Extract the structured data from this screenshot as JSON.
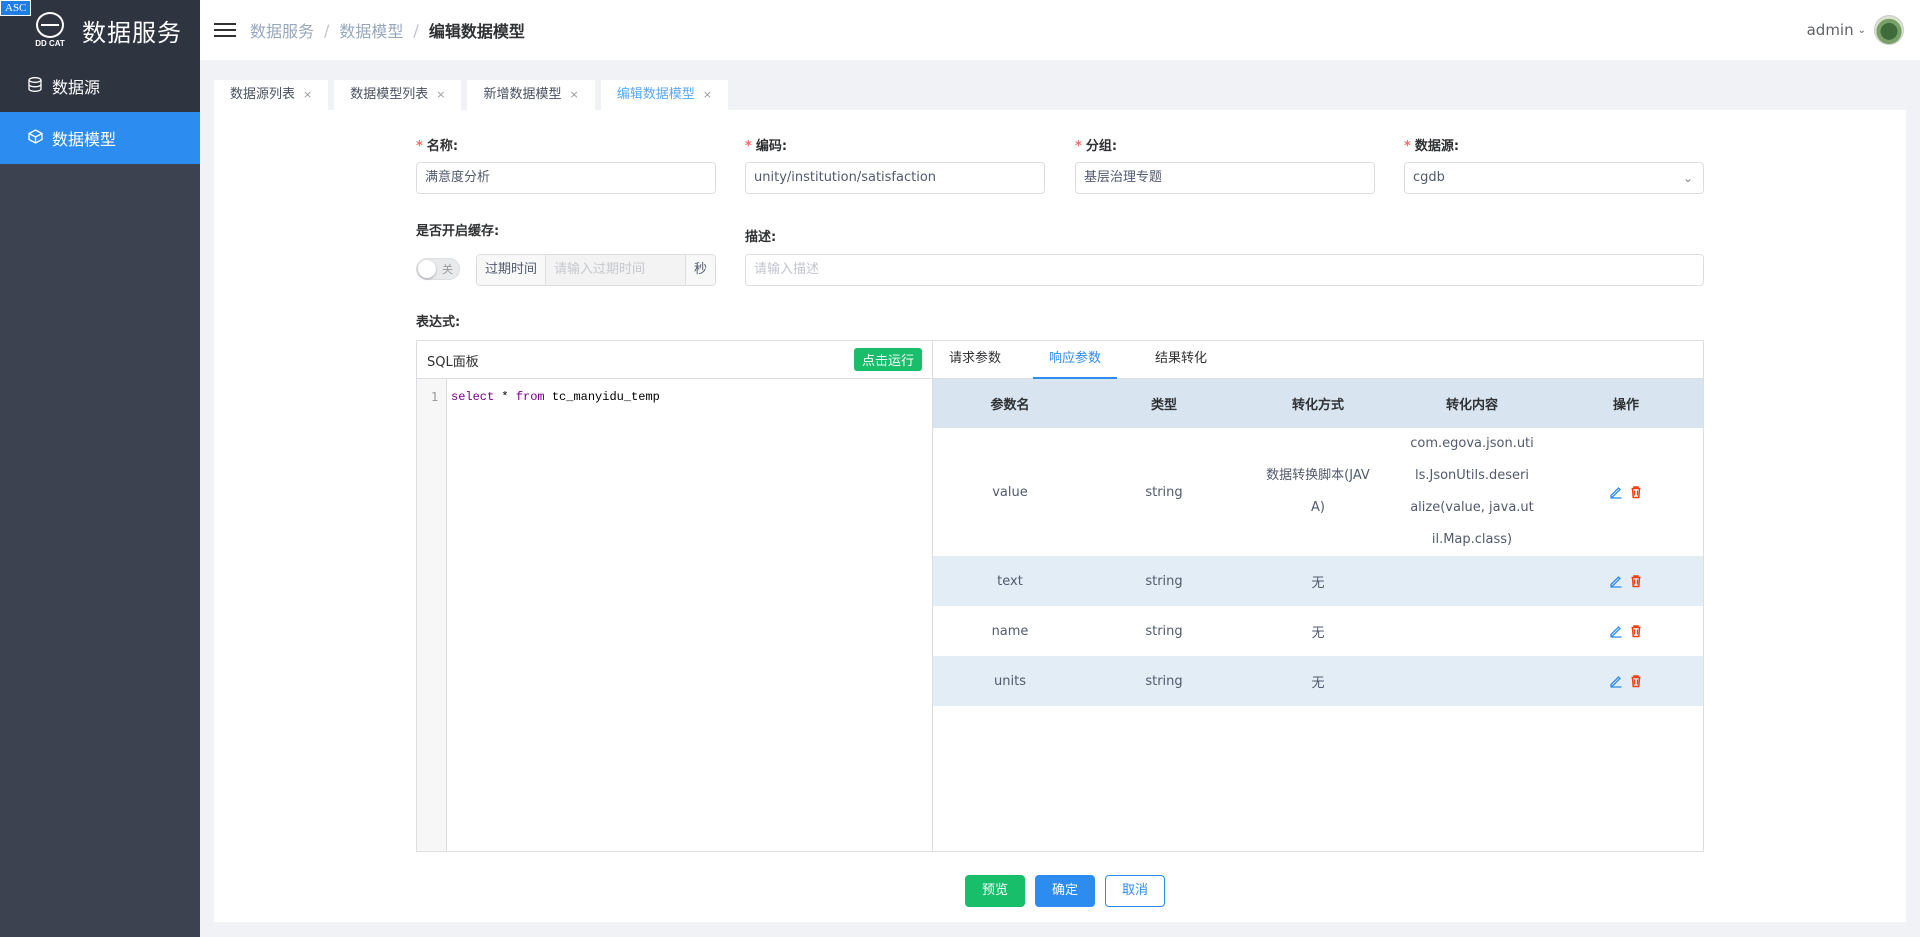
{
  "app": {
    "badge": "ASC",
    "logo_text": "DD CAT",
    "title": "数据服务"
  },
  "sidebar": {
    "items": [
      {
        "label": "数据源"
      },
      {
        "label": "数据模型"
      }
    ]
  },
  "header": {
    "breadcrumb": [
      "数据服务",
      "数据模型",
      "编辑数据模型"
    ],
    "user": "admin"
  },
  "tabs": [
    {
      "label": "数据源列表"
    },
    {
      "label": "数据模型列表"
    },
    {
      "label": "新增数据模型"
    },
    {
      "label": "编辑数据模型"
    }
  ],
  "form": {
    "name_label": "名称:",
    "name_value": "满意度分析",
    "code_label": "编码:",
    "code_value": "unity/institution/satisfaction",
    "group_label": "分组:",
    "group_value": "基层治理专题",
    "datasource_label": "数据源:",
    "datasource_value": "cgdb",
    "cache_label": "是否开启缓存:",
    "cache_switch_text": "关",
    "expire_addon": "过期时间",
    "expire_placeholder": "请输入过期时间",
    "expire_unit": "秒",
    "desc_label": "描述:",
    "desc_placeholder": "请输入描述",
    "expr_label": "表达式:"
  },
  "sql": {
    "title": "SQL面板",
    "run_label": "点击运行",
    "line_number": "1",
    "kw1": "select",
    "star": " * ",
    "kw2": "from",
    "table": " tc_manyidu_temp"
  },
  "right_tabs": [
    "请求参数",
    "响应参数",
    "结果转化"
  ],
  "param_table": {
    "headers": [
      "参数名",
      "类型",
      "转化方式",
      "转化内容",
      "操作"
    ],
    "rows": [
      {
        "name": "value",
        "type": "string",
        "method_l1": "数据转换脚本(JAV",
        "method_l2": "A)",
        "content_l1": "com.egova.json.uti",
        "content_l2": "ls.JsonUtils.deseri",
        "content_l3": "alize(value, java.ut",
        "content_l4": "il.Map.class)"
      },
      {
        "name": "text",
        "type": "string",
        "method": "无",
        "content": ""
      },
      {
        "name": "name",
        "type": "string",
        "method": "无",
        "content": ""
      },
      {
        "name": "units",
        "type": "string",
        "method": "无",
        "content": ""
      }
    ]
  },
  "buttons": {
    "preview": "预览",
    "confirm": "确定",
    "cancel": "取消"
  }
}
